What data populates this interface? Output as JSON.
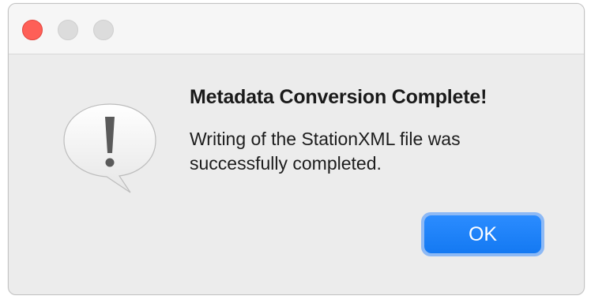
{
  "dialog": {
    "title": "Metadata Conversion Complete!",
    "message": "Writing of the StationXML file was successfully completed.",
    "icon": "caution-speech-bubble-icon"
  },
  "buttons": {
    "ok_label": "OK"
  },
  "window_controls": {
    "close": "close-icon",
    "minimize": "minimize-icon",
    "zoom": "zoom-icon"
  },
  "colors": {
    "close": "#fe5f57",
    "inactive_control": "#dcdcdc",
    "accent": "#1479f2",
    "focus_ring": "#8db9f5",
    "background": "#ececec"
  }
}
